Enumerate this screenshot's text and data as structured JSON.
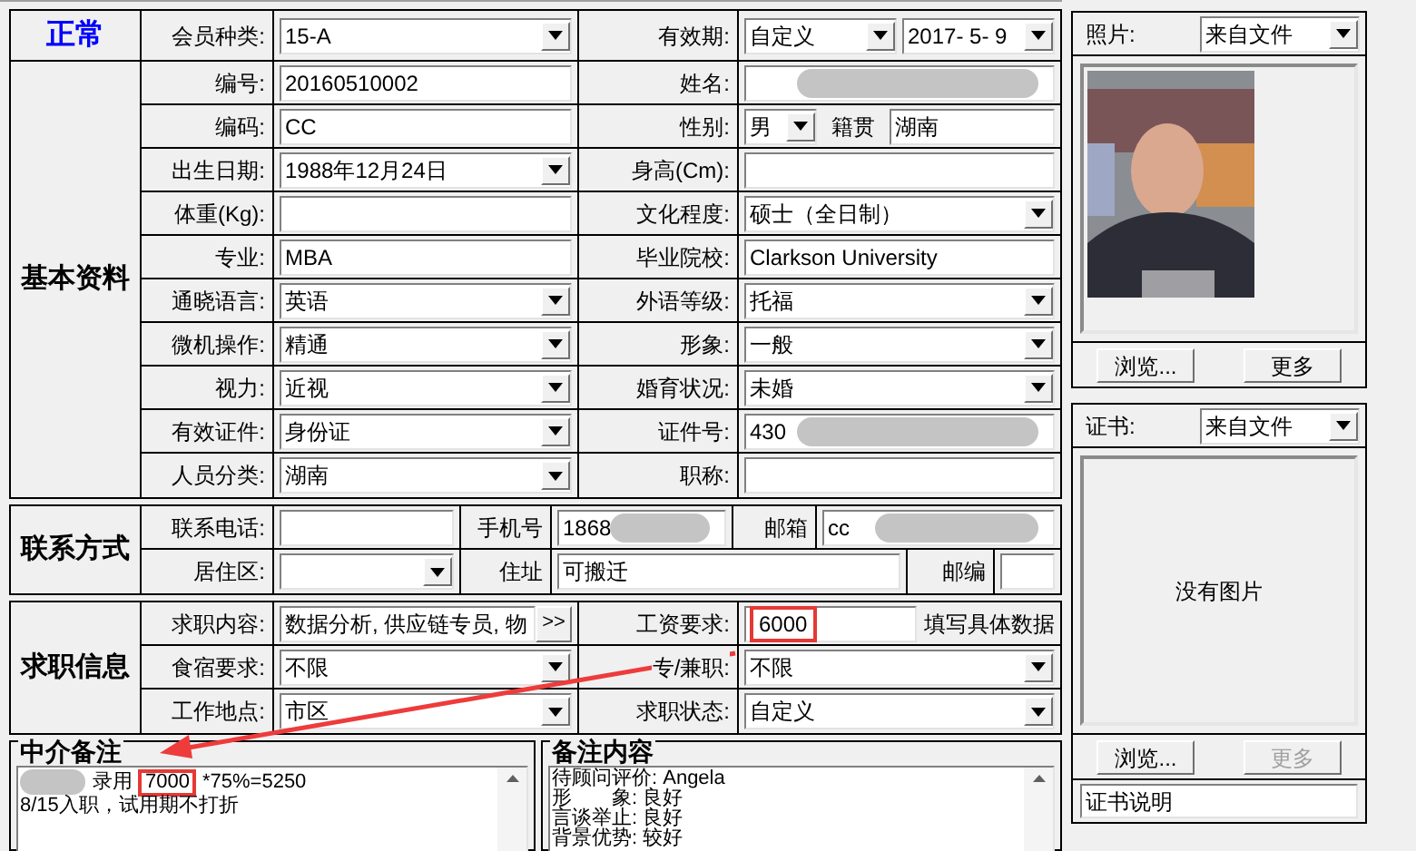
{
  "status": "正常",
  "header": {
    "label": "会员种类:",
    "field": {
      "kind": "select",
      "value": "15-A"
    },
    "label_2": "有效期:",
    "fields_2": [
      {
        "kind": "select",
        "value": "自定义"
      },
      {
        "kind": "select",
        "value": "2017- 5- 9"
      }
    ]
  },
  "basic": {
    "title": "基本资料",
    "rows": [
      {
        "label": "编号:",
        "field": {
          "kind": "key",
          "value": "20160510002"
        },
        "label_2": "姓名:",
        "field_2": {
          "kind": "text",
          "redacted": true
        }
      },
      {
        "label": "编码:",
        "field": {
          "kind": "text",
          "value": "CC"
        },
        "label_2": "性别:",
        "field_2": {
          "kind": "gender",
          "value": "男",
          "extra_label": "籍贯",
          "extra_value": "湖南"
        }
      },
      {
        "label": "出生日期:",
        "field": {
          "kind": "select",
          "value": "1988年12月24日"
        },
        "label_2": "身高(Cm):",
        "field_2": {
          "kind": "text"
        }
      },
      {
        "label": "体重(Kg):",
        "field": {
          "kind": "text"
        },
        "label_2": "文化程度:",
        "field_2": {
          "kind": "select",
          "value": "硕士（全日制）"
        }
      },
      {
        "label": "专业:",
        "field": {
          "kind": "text",
          "value": "MBA"
        },
        "label_2": "毕业院校:",
        "field_2": {
          "kind": "text",
          "value": "Clarkson University"
        }
      },
      {
        "label": "通晓语言:",
        "field": {
          "kind": "select",
          "value": "英语"
        },
        "label_2": "外语等级:",
        "field_2": {
          "kind": "select",
          "value": "托福"
        }
      },
      {
        "label": "微机操作:",
        "field": {
          "kind": "select",
          "value": "精通"
        },
        "label_2": "形象:",
        "field_2": {
          "kind": "select",
          "value": "一般"
        }
      },
      {
        "label": "视力:",
        "field": {
          "kind": "select",
          "value": "近视"
        },
        "label_2": "婚育状况:",
        "field_2": {
          "kind": "select",
          "value": "未婚"
        }
      },
      {
        "label": "有效证件:",
        "field": {
          "kind": "select",
          "value": "身份证"
        },
        "label_2": "证件号:",
        "field_2": {
          "kind": "text",
          "value": "430",
          "redacted": true
        }
      },
      {
        "label": "人员分类:",
        "field": {
          "kind": "select",
          "value": "湖南"
        },
        "label_2": "职称:",
        "field_2": {
          "kind": "text"
        }
      }
    ]
  },
  "contact": {
    "title": "联系方式",
    "rows": [
      [
        {
          "label": "联系电话:"
        },
        {
          "field": {
            "kind": "text"
          }
        },
        {
          "label": "手机号"
        },
        {
          "field": {
            "kind": "text",
            "value": "1868",
            "redacted": true
          }
        },
        {
          "label": "邮箱"
        },
        {
          "field": {
            "kind": "text",
            "value": "cc",
            "redacted": true
          }
        }
      ],
      [
        {
          "label": "居住区:"
        },
        {
          "field": {
            "kind": "select"
          }
        },
        {
          "label": "住址"
        },
        {
          "field": {
            "kind": "text",
            "value": "可搬迁"
          }
        },
        {
          "label": "邮编"
        },
        {
          "field": {
            "kind": "text"
          }
        }
      ]
    ]
  },
  "job": {
    "title": "求职信息",
    "rows": [
      {
        "label": "求职内容:",
        "field": {
          "kind": "multi",
          "value": "数据分析, 供应链专员, 物",
          "button": ">>"
        },
        "label_2": "工资要求:",
        "field_2": {
          "kind": "salary",
          "value": "6000",
          "highlighted": true,
          "hint": "填写具体数据"
        }
      },
      {
        "label": "食宿要求:",
        "field": {
          "kind": "select",
          "value": "不限"
        },
        "label_2": "专/兼职:",
        "field_2": {
          "kind": "select",
          "value": "不限"
        }
      },
      {
        "label": "工作地点:",
        "field": {
          "kind": "select",
          "value": "市区"
        },
        "label_2": "求职状态:",
        "field_2": {
          "kind": "select",
          "value": "自定义"
        }
      }
    ]
  },
  "notes": [
    {
      "title": "中介备注",
      "lines": [
        {
          "redacted": true,
          "parts": [
            {
              "text": "录用",
              "highlighted": false
            },
            {
              "text": "7000",
              "highlighted": true
            },
            {
              "text": "*75%=5250",
              "highlighted": false
            }
          ]
        },
        {
          "redacted": false,
          "parts": [
            {
              "text": "8/15入职，试用期不打折",
              "highlighted": false
            }
          ]
        }
      ]
    },
    {
      "title": "备注内容",
      "lines": [
        {
          "redacted": false,
          "parts": [
            {
              "text": "待顾问评价: Angela",
              "highlighted": false
            }
          ]
        },
        {
          "redacted": false,
          "parts": [
            {
              "text": "形　　象: 良好",
              "highlighted": false
            }
          ]
        },
        {
          "redacted": false,
          "parts": [
            {
              "text": "言谈举止: 良好",
              "highlighted": false
            }
          ]
        },
        {
          "redacted": false,
          "parts": [
            {
              "text": "背景优势: 较好",
              "highlighted": false
            }
          ]
        }
      ]
    }
  ],
  "photo": {
    "label": "照片:",
    "source": "来自文件",
    "buttons": [
      {
        "label": "浏览...",
        "disabled": false
      },
      {
        "label": "更多",
        "disabled": false
      }
    ]
  },
  "certificate": {
    "label": "证书:",
    "source": "来自文件",
    "empty_text": "没有图片",
    "buttons": [
      {
        "label": "浏览...",
        "disabled": false
      },
      {
        "label": "更多",
        "disabled": true
      }
    ],
    "caption": "证书说明"
  }
}
